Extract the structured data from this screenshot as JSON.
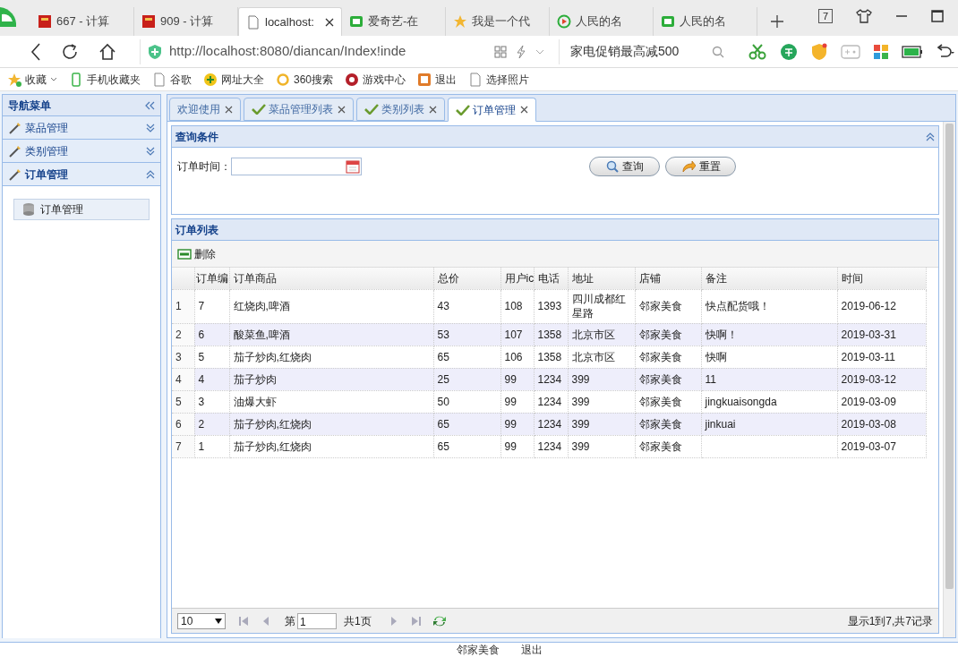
{
  "browser": {
    "tabs": [
      {
        "title": "667 - 计算",
        "selected": false
      },
      {
        "title": "909 - 计算",
        "selected": false
      },
      {
        "title": "localhost:",
        "selected": true
      },
      {
        "title": "爱奇艺-在",
        "selected": false
      },
      {
        "title": "我是一个代",
        "selected": false
      },
      {
        "title": "人民的名",
        "selected": false
      },
      {
        "title": "人民的名",
        "selected": false
      }
    ],
    "tab_count": "7",
    "address": "http://localhost:8080/diancan/Index!inde",
    "search": "家电促销最高减500",
    "bookmarks": [
      "收藏",
      "手机收藏夹",
      "谷歌",
      "网址大全",
      "360搜索",
      "游戏中心",
      "退出",
      "选择照片"
    ]
  },
  "nav": {
    "title": "导航菜单",
    "menus": [
      {
        "label": "菜品管理",
        "expanded": false
      },
      {
        "label": "类别管理",
        "expanded": false
      },
      {
        "label": "订单管理",
        "expanded": true,
        "children": [
          {
            "label": "订单管理",
            "selected": true
          }
        ]
      }
    ]
  },
  "tabs": [
    {
      "label": "欢迎使用",
      "selected": false,
      "kind": "plain"
    },
    {
      "label": "菜品管理列表",
      "selected": false,
      "kind": "check"
    },
    {
      "label": "类别列表",
      "selected": false,
      "kind": "check"
    },
    {
      "label": "订单管理",
      "selected": true,
      "kind": "check"
    }
  ],
  "query": {
    "title": "查询条件",
    "field_label": "订单时间：",
    "buttons": [
      {
        "label": "查询",
        "kind": "search"
      },
      {
        "label": "重置",
        "kind": "reset"
      }
    ]
  },
  "list": {
    "title": "订单列表",
    "toolbar": [
      "删除"
    ],
    "columns": [
      "",
      "订单编",
      "订单商品",
      "总价",
      "用户ic",
      "电话",
      "地址",
      "店铺",
      "备注",
      "时间"
    ],
    "rows": [
      [
        "1",
        "7",
        "红烧肉,啤酒",
        "43",
        "108",
        "1393",
        "四川成都红星路",
        "邻家美食",
        "快点配货哦！",
        "2019-06-12"
      ],
      [
        "2",
        "6",
        "酸菜鱼,啤酒",
        "53",
        "107",
        "1358",
        "北京市区",
        "邻家美食",
        "快啊！",
        "2019-03-31"
      ],
      [
        "3",
        "5",
        "茄子炒肉,红烧肉",
        "65",
        "106",
        "1358",
        "北京市区",
        "邻家美食",
        "快啊",
        "2019-03-11"
      ],
      [
        "4",
        "4",
        "茄子炒肉",
        "25",
        "99",
        "1234",
        "399",
        "邻家美食",
        "11",
        "2019-03-12"
      ],
      [
        "5",
        "3",
        "油爆大虾",
        "50",
        "99",
        "1234",
        "399",
        "邻家美食",
        "jingkuaisongda",
        "2019-03-09"
      ],
      [
        "6",
        "2",
        "茄子炒肉,红烧肉",
        "65",
        "99",
        "1234",
        "399",
        "邻家美食",
        "jinkuai",
        "2019-03-08"
      ],
      [
        "7",
        "1",
        "茄子炒肉,红烧肉",
        "65",
        "99",
        "1234",
        "399",
        "邻家美食",
        "",
        "2019-03-07"
      ]
    ]
  },
  "pager": {
    "page_size": "10",
    "page_prefix": "第",
    "page": "1",
    "total": "共1页",
    "summary": "显示1到7,共7记录"
  },
  "footer": [
    "邻家美食",
    "退出"
  ]
}
